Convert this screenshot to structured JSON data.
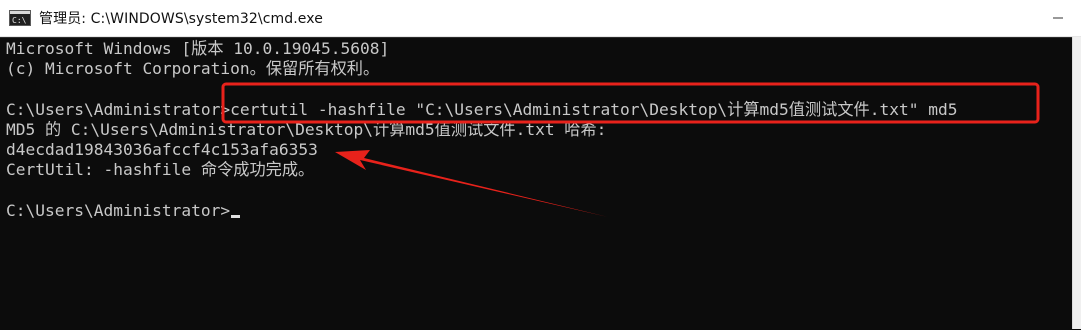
{
  "window": {
    "title": "管理员: C:\\WINDOWS\\system32\\cmd.exe",
    "icon": "cmd-icon",
    "controls": [
      "minimize-icon",
      "maximize-icon",
      "close-icon"
    ]
  },
  "console": {
    "lines": [
      "Microsoft Windows [版本 10.0.19045.5608]",
      "(c) Microsoft Corporation。保留所有权利。",
      "",
      "C:\\Users\\Administrator>certutil -hashfile \"C:\\Users\\Administrator\\Desktop\\计算md5值测试文件.txt\" md5",
      "MD5 的 C:\\Users\\Administrator\\Desktop\\计算md5值测试文件.txt 哈希:",
      "d4ecdad19843036afccf4c153afa6353",
      "CertUtil: -hashfile 命令成功完成。",
      "",
      "C:\\Users\\Administrator>"
    ]
  },
  "annotations": {
    "box_color": "#e8221b",
    "arrow_color": "#e8221b"
  },
  "colors": {
    "console_bg": "#0c0c0c",
    "console_text": "#c8c8c8"
  }
}
